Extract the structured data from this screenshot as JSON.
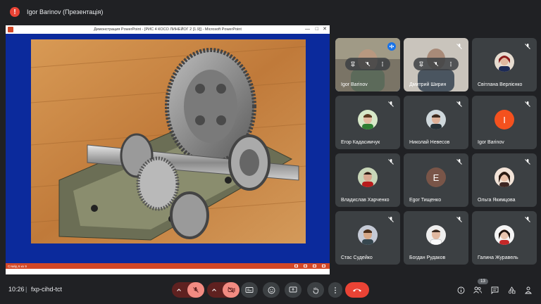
{
  "top": {
    "presenter_title": "Igor Barinov (Презентація)",
    "icon_letter": "!"
  },
  "share": {
    "window_title": "Демонстрация PowerPoint - [РИС 4 КОСО ЛИНЕЙОГ 2 [1.9]] - Microsoft PowerPoint",
    "status_text": "Слайд 6 из 9",
    "controls": [
      "—",
      "□",
      "✕"
    ]
  },
  "tiles": [
    {
      "name": "Igor Barinov",
      "type": "video",
      "active": true,
      "speaking": true
    },
    {
      "name": "Дмитрий Ширин",
      "type": "video",
      "active": false
    },
    {
      "name": "Світлана Верлієнко",
      "type": "photo",
      "active": false
    },
    {
      "name": "Егор Кадасимчук",
      "type": "photo",
      "active": false
    },
    {
      "name": "Николай Невесов",
      "type": "photo",
      "active": false
    },
    {
      "name": "Igor Barinov",
      "type": "letter",
      "letter": "I",
      "color": "#f4511e"
    },
    {
      "name": "Владислав Харченко",
      "type": "photo",
      "active": false
    },
    {
      "name": "Egor Тищенко",
      "type": "letter",
      "letter": "E",
      "color": "#795548"
    },
    {
      "name": "Ольга Якимцова",
      "type": "photo",
      "active": false
    },
    {
      "name": "Стас Судейко",
      "type": "photo",
      "active": false
    },
    {
      "name": "Богдан Рудаков",
      "type": "photo",
      "active": false
    },
    {
      "name": "Галина Журавель",
      "type": "photo",
      "active": false
    }
  ],
  "bottom": {
    "time": "10:26",
    "separator": "|",
    "meeting_code": "fxp-cihd-tct",
    "people_count": "13"
  },
  "colors": {
    "accent": "#8ab4f8",
    "danger": "#ea4335",
    "tile": "#3c4043",
    "bg": "#202124"
  }
}
